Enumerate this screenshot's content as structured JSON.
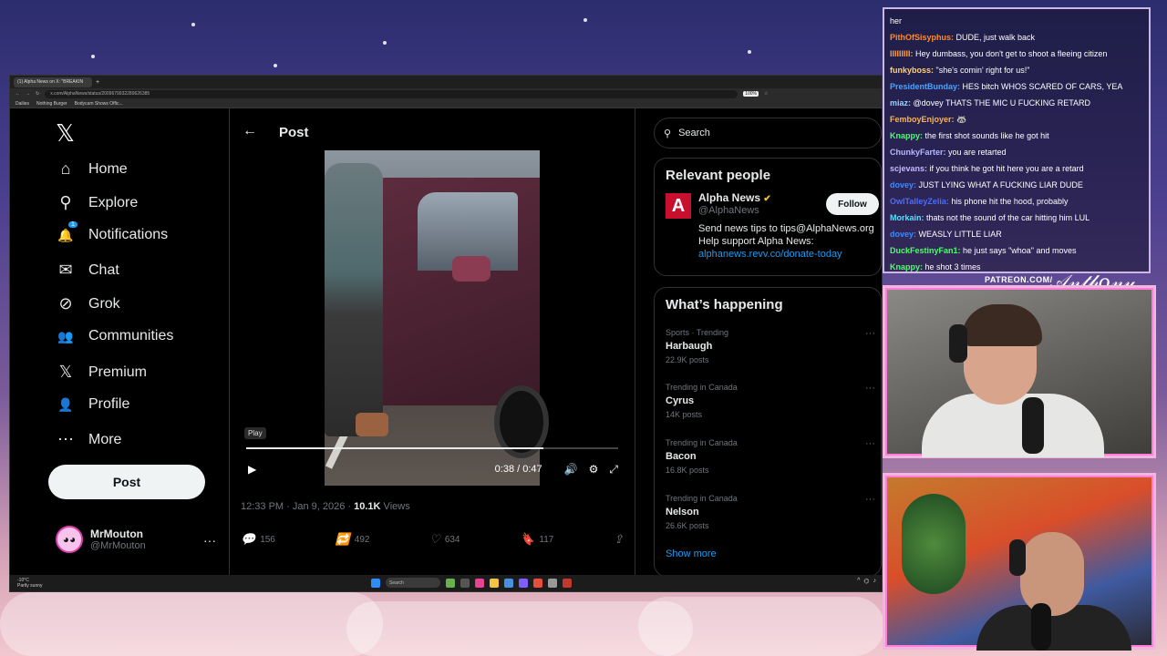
{
  "browser": {
    "tab_title": "(1) Alpha News on X: \"BREAKIN",
    "new_tab": "+",
    "url": "x.com/AlphaNews/status/2009679932289626385",
    "zoom": "100%",
    "bookmarks": [
      "Dailies",
      "Nothing Burger",
      "Bodycam Shows Offic..."
    ]
  },
  "x": {
    "logo": "𝕏",
    "nav": [
      {
        "label": "Home",
        "icon": "home-icon",
        "glyph": "⌂"
      },
      {
        "label": "Explore",
        "icon": "search-icon",
        "glyph": "⚲"
      },
      {
        "label": "Notifications",
        "icon": "bell-icon",
        "glyph": "🔔"
      },
      {
        "label": "Chat",
        "icon": "mail-icon",
        "glyph": "✉"
      },
      {
        "label": "Grok",
        "icon": "grok-icon",
        "glyph": "⊘"
      },
      {
        "label": "Communities",
        "icon": "people-icon",
        "glyph": "👥"
      },
      {
        "label": "Premium",
        "icon": "x-premium-icon",
        "glyph": "𝕏"
      },
      {
        "label": "Profile",
        "icon": "person-icon",
        "glyph": "👤"
      },
      {
        "label": "More",
        "icon": "more-circle-icon",
        "glyph": "⋯"
      }
    ],
    "notifications_badge": "1",
    "post_button": "Post",
    "profile": {
      "name": "MrMouton",
      "handle": "@MrMouton",
      "more": "···"
    },
    "post": {
      "back_glyph": "←",
      "title": "Post",
      "video": {
        "tooltip": "Play",
        "time": "0:38 / 0:47",
        "progress": 0.8
      },
      "meta_time": "12:33 PM · Jan 9, 2026 · ",
      "views_count": "10.1K",
      "views_label": " Views",
      "actions": {
        "replies": "156",
        "reposts": "492",
        "likes": "634",
        "bookmarks": "117"
      }
    },
    "sidebar": {
      "search_placeholder": "Search",
      "relevant_title": "Relevant people",
      "person": {
        "logo": "A",
        "name": "Alpha News",
        "handle": "@AlphaNews",
        "follow": "Follow",
        "bio1": "Send news tips to tips@AlphaNews.org",
        "bio2": "Help support Alpha News:",
        "bio_link": "alphanews.revv.co/donate-today"
      },
      "happening_title": "What’s happening",
      "trends": [
        {
          "context": "Sports · Trending",
          "name": "Harbaugh",
          "count": "22.9K posts"
        },
        {
          "context": "Trending in Canada",
          "name": "Cyrus",
          "count": "14K posts"
        },
        {
          "context": "Trending in Canada",
          "name": "Bacon",
          "count": "16.8K posts"
        },
        {
          "context": "Trending in Canada",
          "name": "Nelson",
          "count": "26.6K posts"
        }
      ],
      "show_more": "Show more"
    }
  },
  "taskbar": {
    "weather_line1": "-10°C",
    "weather_line2": "Partly sunny",
    "search": "Search"
  },
  "chat": [
    {
      "user": "",
      "text": "her",
      "color": "#ffffff"
    },
    {
      "user": "PithOfSisyphus:",
      "text": "DUDE, just walk back",
      "color": "#ff8c2a"
    },
    {
      "user": "IIIIIIIII:",
      "text": "Hey dumbass, you don't get to shoot a fleeing citizen",
      "color": "#ff9f43"
    },
    {
      "user": "funkyboss:",
      "text": "\"she's comin' right for us!\"",
      "color": "#ffd27a"
    },
    {
      "user": "PresidentBunday:",
      "text": "HES bitch WHOS SCARED OF CARS, YEA",
      "color": "#4aa3ff"
    },
    {
      "user": "miaz:",
      "text": "@dovey THATS THE MIC U FUCKING RETARD",
      "color": "#9ad0ff"
    },
    {
      "user": "FemboyEnjoyer:",
      "text": "🦝",
      "color": "#ffb347"
    },
    {
      "user": "Knappy:",
      "text": "the first shot sounds like he got hit",
      "color": "#4cff6b"
    },
    {
      "user": "ChunkyFarter:",
      "text": "you are retarted",
      "color": "#b8b8ff"
    },
    {
      "user": "scjevans:",
      "text": "if you think he got hit here you are a retard",
      "color": "#c6b7ff"
    },
    {
      "user": "dovey:",
      "text": "JUST LYING WHAT A FUCKING LIAR DUDE",
      "color": "#3d8bff"
    },
    {
      "user": "OwlTalleyZelia:",
      "text": "his phone hit the hood, probably",
      "color": "#4a6dff"
    },
    {
      "user": "Morkain:",
      "text": "thats not the sound of the car hitting him LUL",
      "color": "#4fe3ff"
    },
    {
      "user": "dovey:",
      "text": "WEASLY LITTLE LIAR",
      "color": "#3d8bff"
    },
    {
      "user": "DuckFestinyFan1:",
      "text": "he just says \"whoa\" and moves",
      "color": "#4cff6b"
    },
    {
      "user": "Knappy:",
      "text": "he shot 3 times",
      "color": "#4cff6b"
    }
  ],
  "overlay": {
    "patreon": "PATREON.COM/",
    "signature": "Anthony"
  }
}
